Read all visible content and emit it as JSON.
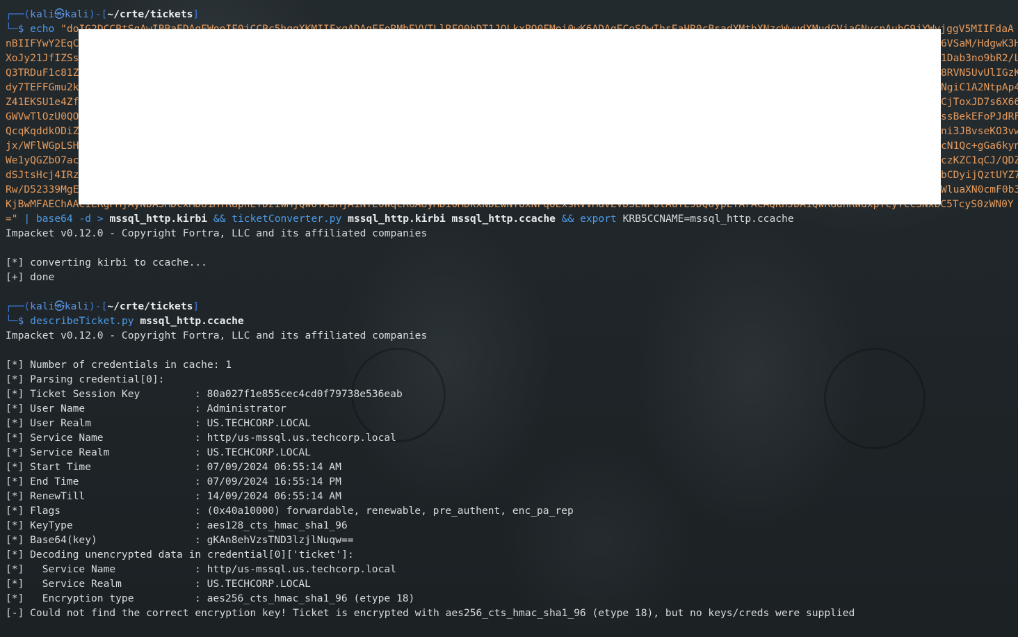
{
  "prompt": {
    "user_host": "kali㉿kali",
    "cwd": "~/crte/tickets",
    "dollar": "$"
  },
  "cmd1": {
    "echo": "echo",
    "b64_lines": [
      "\"doIG2DCCBtSgAwIBBaEDAgEWooIF0jCCBc5hggXKMIIFxqADAgEFoRMbEVVTLlRFQ0hDT1JQLkxPQ0FMoi0wK6ADAgECoSQwIhsEaHR0cBsadXMtbXNzcWwudXMudGVjaGNvcnAubG9jYWyjggV5MIIFdaADAgESoQMCAQGiggV",
      "nBIIFYwY2EqCy",
      "XoJy21JfIZSsO",
      "Q3TRDuF1c81Zi",
      "dy7TEFFGmu2km",
      "Z41EKSU1e4Zfe",
      "GWVwTlOzU0QOi",
      "QcqKqddkODiZh",
      "jx/WFlWGpLSHg",
      "We1yQGZbO7ac7",
      "dSJtsHcj4IRzK",
      "Rw/D52339MgEb",
      "KjBwMFAEChAACiERgPMjAyNDA5MDcxMDU1MTRaphEYDzIwMjQwOTA5MjA1NTE0WqcRGA8yMDI0MDkxNDEwNTUxNFqoExsRVVMuVEVDSENPUlAuTE9DQUypLTArACAQKhJDA1QwRGdhRWdxpTcyTcCSNxbC5TcyS0zWN0YzY2ycC5sb2NhbA="
    ],
    "b64_right": [
      "6VSaM/HdgwK3H",
      "1Dab3no9bR2/L",
      "8RVN5UvUlIGzK",
      "NgiC1A2NtpAp4",
      "CjToxJD7s6X66",
      "ssBekEFoPJdRF",
      "ni3JBvseKO3vw",
      "cN1Qc+gGa6kyn",
      "czKZC1qCJ/QDZ",
      "bCDyijQztUYZ7",
      "WluaXN0cmF0b3"
    ],
    "tail_str": "=\"",
    "pipe": "|",
    "base64": "base64",
    "flag": "-d",
    "gt": ">",
    "kirbi": "mssql_http.kirbi",
    "and1": "&&",
    "converter": "ticketConverter.py",
    "conv_args": "mssql_http.kirbi mssql_http.ccache",
    "and2": "&&",
    "export": "export",
    "export_arg": "KRB5CCNAME=mssql_http.ccache"
  },
  "out1": {
    "banner": "Impacket v0.12.0 - Copyright Fortra, LLC and its affiliated companies",
    "converting": "[*] converting kirbi to ccache...",
    "done": "[+] done"
  },
  "cmd2": {
    "tool": "describeTicket.py",
    "arg": "mssql_http.ccache"
  },
  "out2": {
    "banner": "Impacket v0.12.0 - Copyright Fortra, LLC and its affiliated companies",
    "num_creds": "[*] Number of credentials in cache: 1",
    "parsing": "[*] Parsing credential[0]:",
    "fields": [
      {
        "k": "[*] Ticket Session Key",
        "v": ": 80a027f1e855cec4cd0f79738e536eab"
      },
      {
        "k": "[*] User Name",
        "v": ": Administrator"
      },
      {
        "k": "[*] User Realm",
        "v": ": US.TECHCORP.LOCAL"
      },
      {
        "k": "[*] Service Name",
        "v": ": http/us-mssql.us.techcorp.local"
      },
      {
        "k": "[*] Service Realm",
        "v": ": US.TECHCORP.LOCAL"
      },
      {
        "k": "[*] Start Time",
        "v": ": 07/09/2024 06:55:14 AM"
      },
      {
        "k": "[*] End Time",
        "v": ": 07/09/2024 16:55:14 PM"
      },
      {
        "k": "[*] RenewTill",
        "v": ": 14/09/2024 06:55:14 AM"
      },
      {
        "k": "[*] Flags",
        "v": ": (0x40a10000) forwardable, renewable, pre_authent, enc_pa_rep"
      },
      {
        "k": "[*] KeyType",
        "v": ": aes128_cts_hmac_sha1_96"
      },
      {
        "k": "[*] Base64(key)",
        "v": ": gKAn8ehVzsTND3lzjlNuqw=="
      }
    ],
    "decoding": "[*] Decoding unencrypted data in credential[0]['ticket']:",
    "sub_fields": [
      {
        "k": "[*]   Service Name",
        "v": ": http/us-mssql.us.techcorp.local"
      },
      {
        "k": "[*]   Service Realm",
        "v": ": US.TECHCORP.LOCAL"
      },
      {
        "k": "[*]   Encryption type",
        "v": ": aes256_cts_hmac_sha1_96 (etype 18)"
      }
    ],
    "error": "[-] Could not find the correct encryption key! Ticket is encrypted with aes256_cts_hmac_sha1_96 (etype 18), but no keys/creds were supplied"
  }
}
